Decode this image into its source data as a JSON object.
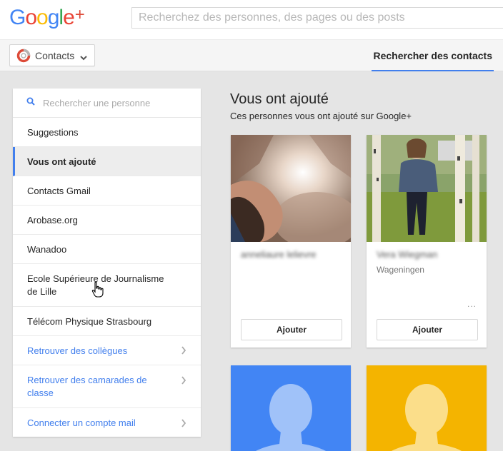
{
  "logo": {
    "letters": [
      "G",
      "o",
      "o",
      "g",
      "l",
      "e"
    ],
    "plus": "+"
  },
  "colors": {
    "blue": "#4285f4",
    "red": "#ea4335",
    "yellow": "#fbbc05",
    "green": "#34a853",
    "accent": "#427fed"
  },
  "search": {
    "placeholder": "Recherchez des personnes, des pages ou des posts"
  },
  "app_switcher": {
    "label": "Contacts",
    "icon": "contacts-circle-icon"
  },
  "tabs": {
    "active": "Rechercher des contacts"
  },
  "sidebar": {
    "search_placeholder": "Rechercher une personne",
    "items": [
      {
        "label": "Suggestions"
      },
      {
        "label": "Vous ont ajouté",
        "active": true
      },
      {
        "label": "Contacts Gmail"
      },
      {
        "label": "Arobase.org"
      },
      {
        "label": "Wanadoo"
      },
      {
        "label": "Ecole Supérieure de Journalisme de Lille"
      },
      {
        "label": "Télécom Physique Strasbourg"
      }
    ],
    "links": [
      {
        "label": "Retrouver des collègues"
      },
      {
        "label": "Retrouver des camarades de classe"
      },
      {
        "label": "Connecter un compte mail"
      }
    ]
  },
  "main": {
    "title": "Vous ont ajouté",
    "subtitle": "Ces personnes vous ont ajouté sur Google+",
    "cards": [
      {
        "name": "anneliaure lelievre",
        "location": "",
        "button": "Ajouter"
      },
      {
        "name": "Vera Wiegman",
        "location": "Wageningen",
        "more": "...",
        "button": "Ajouter"
      },
      {
        "placeholder_color": "#4285f4"
      },
      {
        "placeholder_color": "#f4b400"
      }
    ]
  }
}
